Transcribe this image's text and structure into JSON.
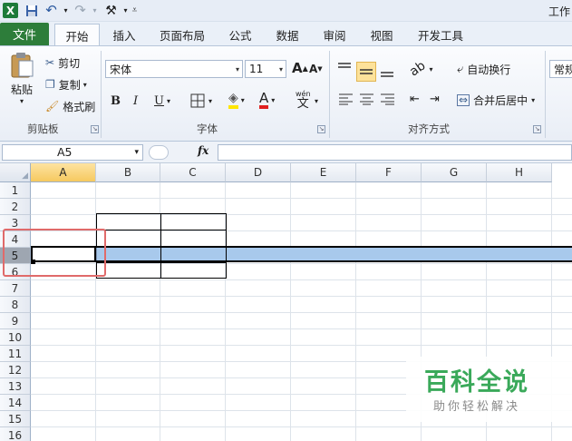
{
  "title_bar": {
    "title_partial": "工作",
    "quick_access": [
      "excel-logo-icon",
      "save-icon",
      "undo-icon",
      "redo-icon",
      "tools-icon",
      "customize-icon"
    ]
  },
  "tabs": [
    "文件",
    "开始",
    "插入",
    "页面布局",
    "公式",
    "数据",
    "审阅",
    "视图",
    "开发工具"
  ],
  "active_tab": "开始",
  "ribbon": {
    "clipboard": {
      "paste": "粘贴",
      "cut": "剪切",
      "copy": "复制",
      "format_painter": "格式刷",
      "group": "剪贴板"
    },
    "font": {
      "name": "宋体",
      "size": "11",
      "bold": "B",
      "italic": "I",
      "underline": "U",
      "grow": "A",
      "shrink": "A",
      "wen": "wén",
      "wen_char": "文",
      "color_a": "A",
      "group": "字体"
    },
    "alignment": {
      "wrap": "自动换行",
      "merge": "合并后居中",
      "group": "对齐方式"
    },
    "number": {
      "format": "常规"
    }
  },
  "formula_bar": {
    "name_box": "A5",
    "fx": "fx",
    "value": ""
  },
  "sheet": {
    "columns": [
      "A",
      "B",
      "C",
      "D",
      "E",
      "F",
      "G",
      "H"
    ],
    "rows": [
      "1",
      "2",
      "3",
      "4",
      "5",
      "6",
      "7",
      "8",
      "9",
      "10",
      "11",
      "12",
      "13",
      "14",
      "15",
      "16"
    ],
    "selected_cell": "A5",
    "selected_row": "5"
  },
  "colors": {
    "file_tab": "#2d7d3a",
    "selection_fill": "#a8c9ec",
    "highlight_box": "#e06a6a",
    "header_selected": "#f6c95f",
    "watermark_green": "#3aa95a"
  },
  "watermark": {
    "title": "百科全说",
    "subtitle": "助你轻松解决"
  }
}
